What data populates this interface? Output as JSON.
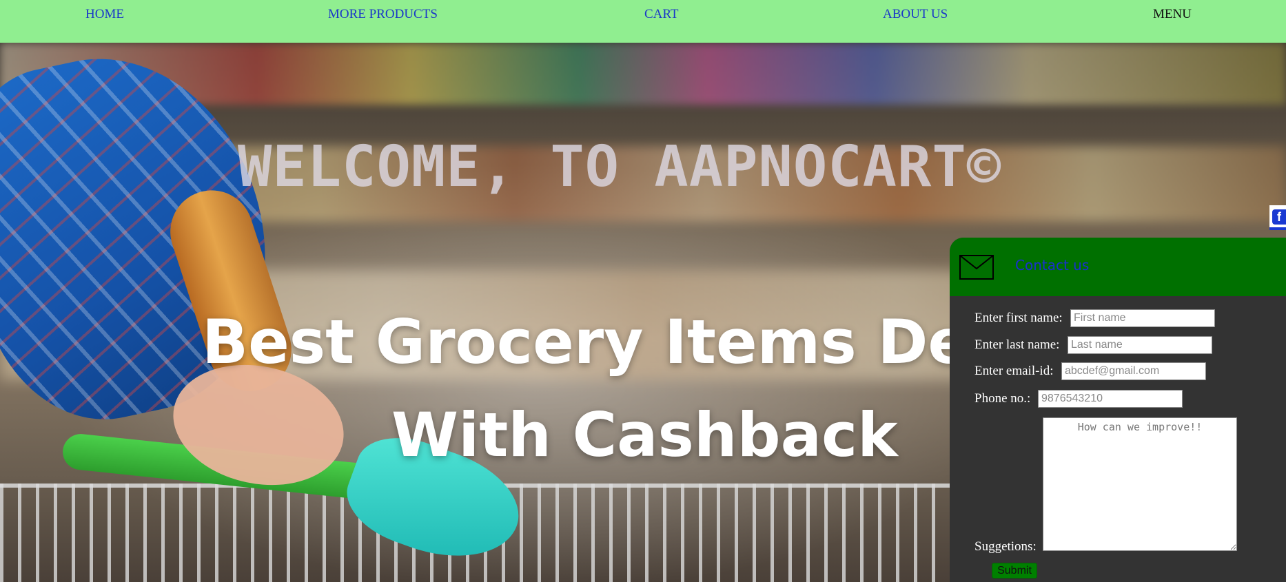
{
  "nav": {
    "home": "HOME",
    "more_products": "MORE PRODUCTS",
    "cart": "CART",
    "about_us": "ABOUT US",
    "menu": "MENU"
  },
  "hero": {
    "welcome": "WELCOME, TO AAPNOCART©",
    "headline_line1": "Best Grocery Items De",
    "headline_line2": "With Cashback"
  },
  "social": {
    "icon": "facebook-icon",
    "glyph": "f"
  },
  "contact": {
    "title": "Contact us",
    "icon": "mail-icon",
    "first_name_label": "Enter first name:",
    "first_name_placeholder": "First name",
    "last_name_label": "Enter last name:",
    "last_name_placeholder": "Last name",
    "email_label": "Enter email-id:",
    "email_placeholder": "abcdef@gmail.com",
    "phone_label": "Phone no.:",
    "phone_placeholder": "9876543210",
    "suggestions_label": "Suggetions:",
    "suggestions_placeholder": "How can we improve!!",
    "submit_label": "Submit"
  },
  "colors": {
    "nav_bg": "#90ee90",
    "nav_link": "#1a37c8",
    "contact_header": "#007000",
    "contact_body": "#333333",
    "submit_bg": "#008000"
  }
}
